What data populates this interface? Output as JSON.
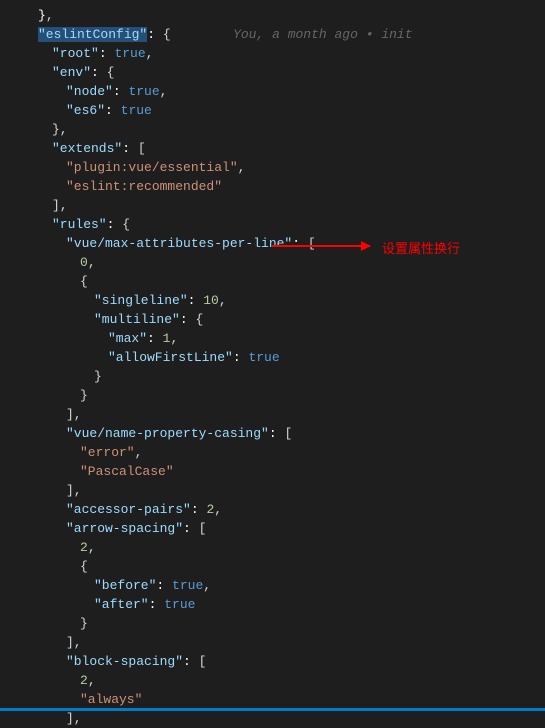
{
  "gitlens": {
    "author": "You",
    "time": "a month ago",
    "message": "init"
  },
  "code": {
    "k_eslintConfig": "\"eslintConfig\"",
    "k_root": "\"root\"",
    "k_env": "\"env\"",
    "k_node": "\"node\"",
    "k_es6": "\"es6\"",
    "k_extends": "\"extends\"",
    "v_plugin": "\"plugin:vue/essential\"",
    "v_eslintrec": "\"eslint:recommended\"",
    "k_rules": "\"rules\"",
    "k_vuemax": "\"vue/max-attributes-per-line\"",
    "v_zero": "0",
    "k_singleline": "\"singleline\"",
    "v_ten": "10",
    "k_multiline": "\"multiline\"",
    "k_max": "\"max\"",
    "v_one": "1",
    "k_allowFirst": "\"allowFirstLine\"",
    "v_true": "true",
    "k_vuename": "\"vue/name-property-casing\"",
    "v_error": "\"error\"",
    "v_pascal": "\"PascalCase\"",
    "k_accessor": "\"accessor-pairs\"",
    "v_two": "2",
    "k_arrowsp": "\"arrow-spacing\"",
    "k_before": "\"before\"",
    "k_after": "\"after\"",
    "k_blocksp": "\"block-spacing\"",
    "v_always": "\"always\""
  },
  "annotation": "设置属性换行"
}
